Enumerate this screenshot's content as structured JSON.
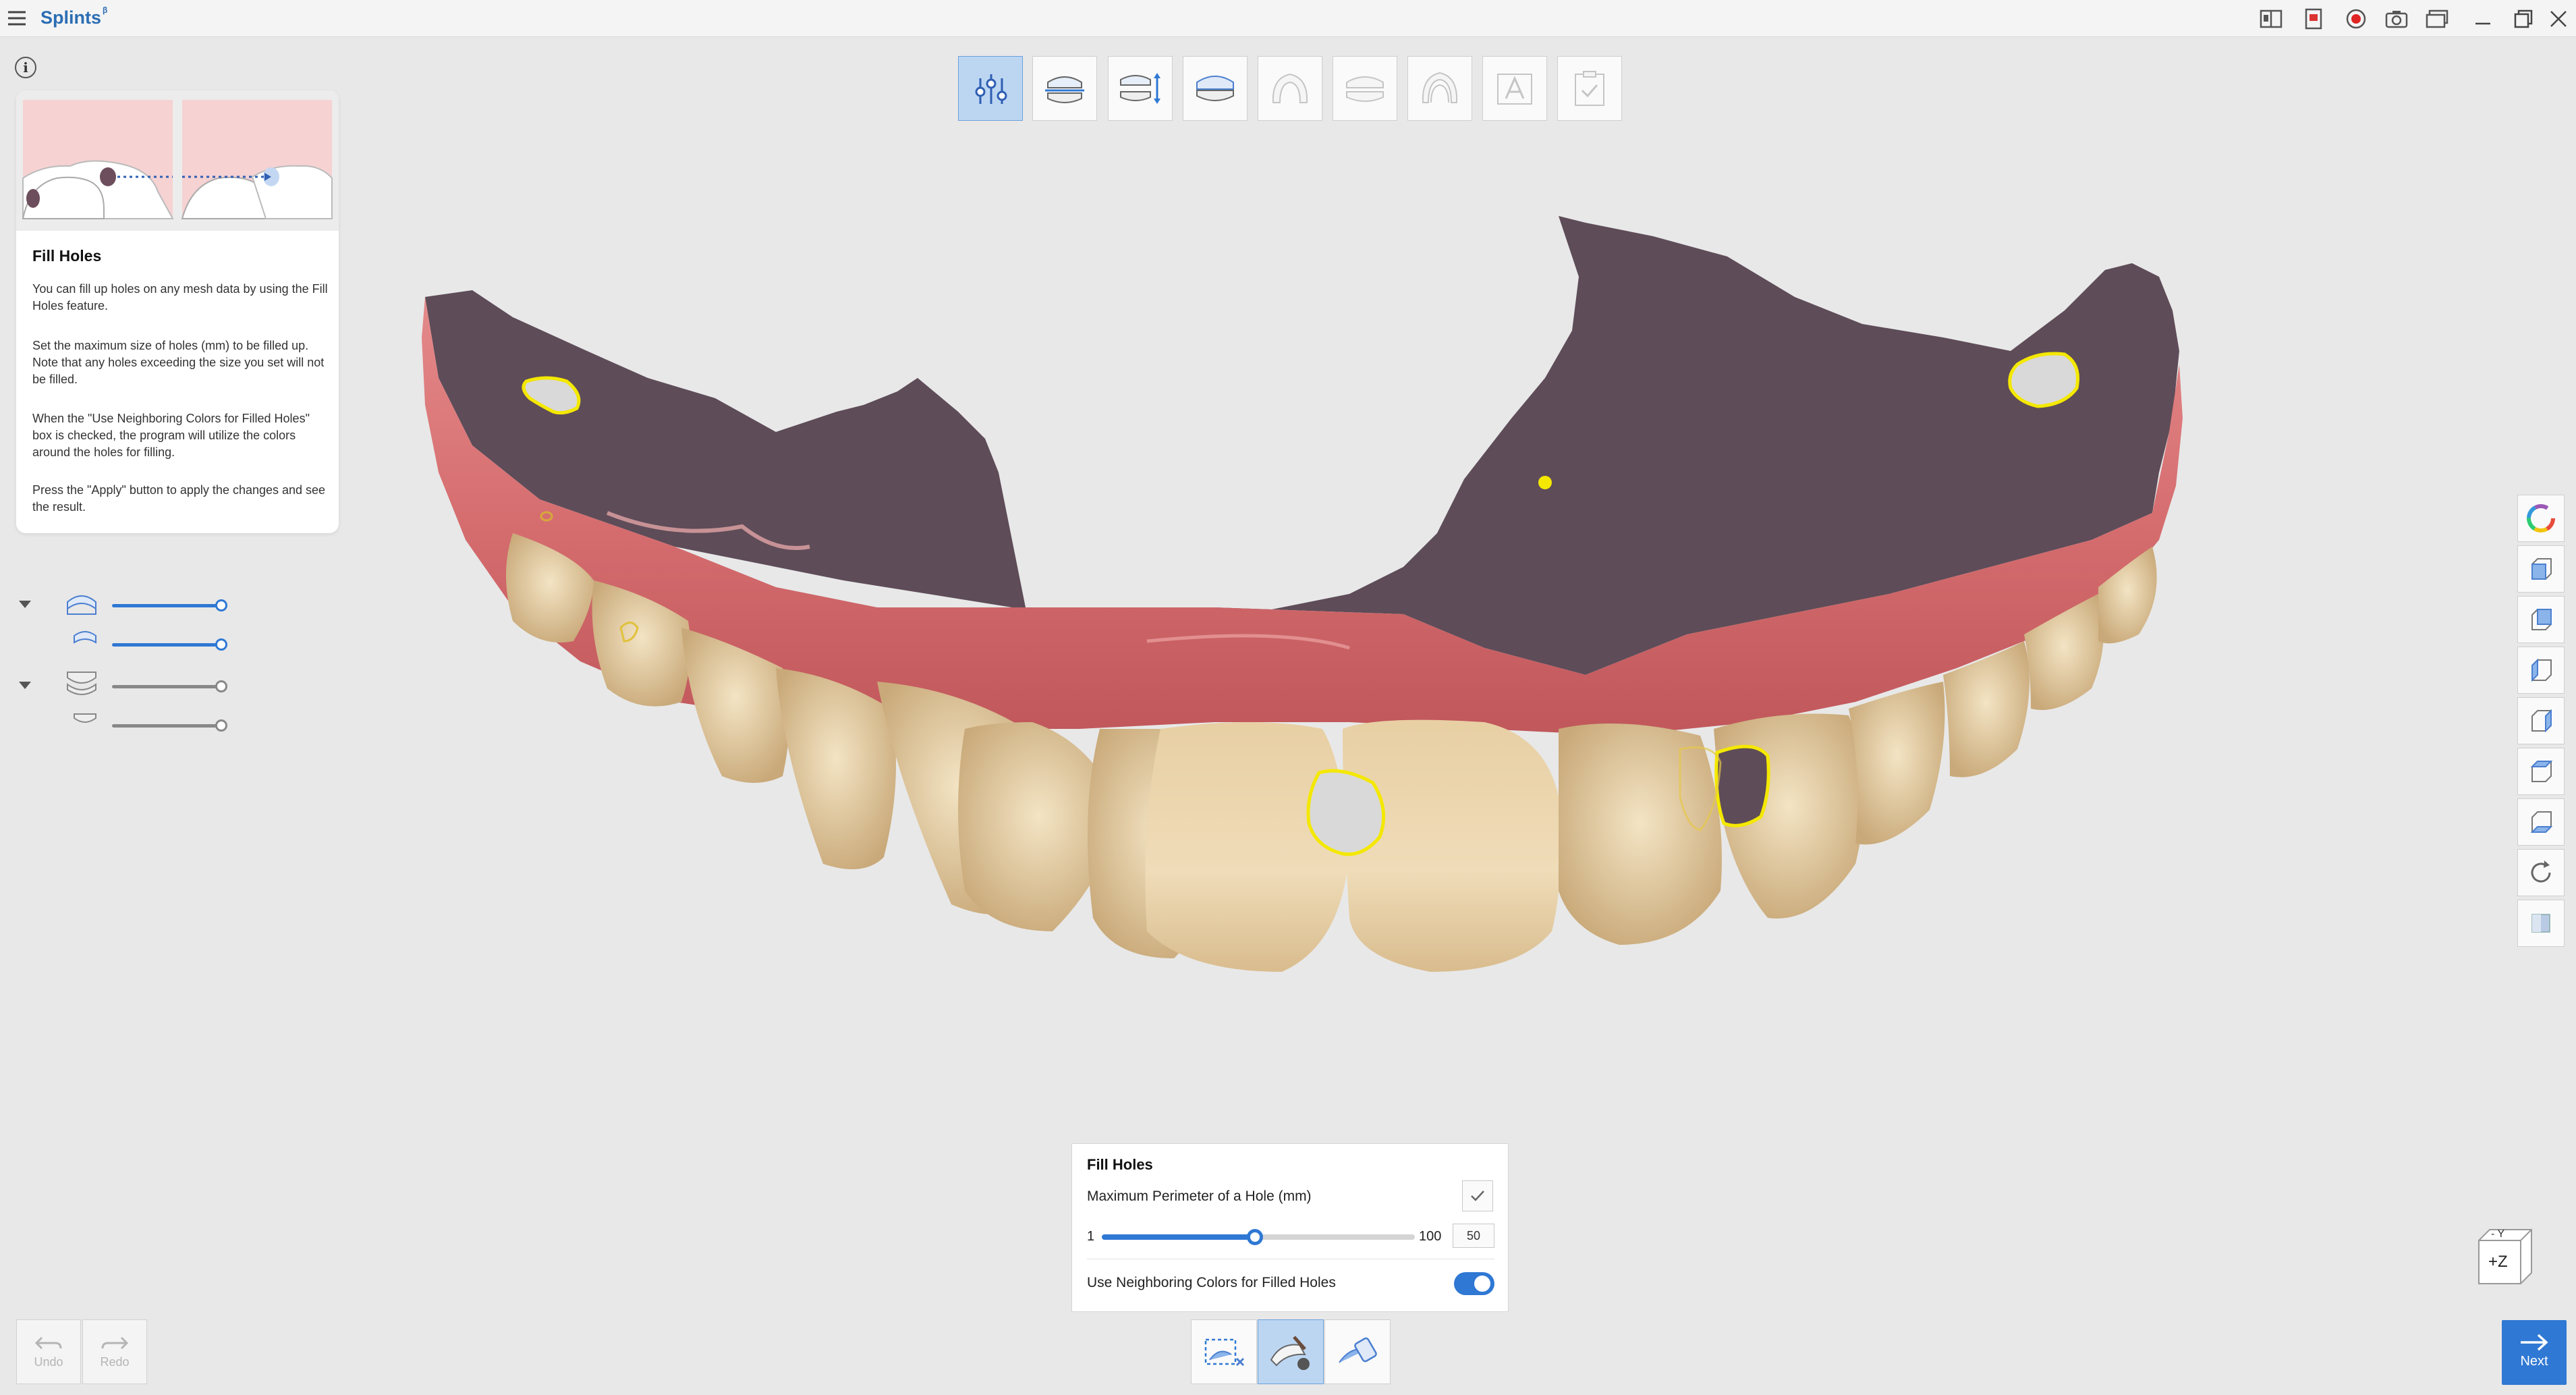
{
  "app": {
    "title": "Splints",
    "badge": "β"
  },
  "titlebar_icons": [
    "split-view-icon",
    "report-icon",
    "record-icon",
    "camera-icon",
    "window-icon",
    "minimize-icon",
    "maximize-icon",
    "close-icon"
  ],
  "help": {
    "title": "Fill Holes",
    "paragraphs": [
      "You can fill up holes on any mesh data by using the Fill Holes feature.",
      "Set the maximum size of holes (mm) to be filled up. Note that any holes exceeding the size you set will not be filled.",
      "When the \"Use Neighboring Colors for Filled Holes\" box is checked, the program will utilize the colors around the holes for filling.",
      "Press the \"Apply\" button to apply the changes and see the result."
    ]
  },
  "layers": [
    {
      "icon": "upper-jaw-icon",
      "visibility": 1.0,
      "group": true
    },
    {
      "icon": "upper-scan-icon",
      "visibility": 1.0,
      "group": false
    },
    {
      "icon": "lower-jaw-icon",
      "visibility": 1.0,
      "group": true
    },
    {
      "icon": "lower-scan-icon",
      "visibility": 1.0,
      "group": false
    }
  ],
  "top_tools": [
    {
      "name": "data-edit-tool",
      "active": true,
      "enabled": true
    },
    {
      "name": "occlusion-tool",
      "active": false,
      "enabled": true
    },
    {
      "name": "align-tool",
      "active": false,
      "enabled": true
    },
    {
      "name": "bite-tool",
      "active": false,
      "enabled": true
    },
    {
      "name": "splint-design-tool",
      "active": false,
      "enabled": false
    },
    {
      "name": "thickness-tool",
      "active": false,
      "enabled": false
    },
    {
      "name": "shell-tool",
      "active": false,
      "enabled": false
    },
    {
      "name": "text-tool",
      "active": false,
      "enabled": false
    },
    {
      "name": "finish-tool",
      "active": false,
      "enabled": false
    }
  ],
  "view_tools": [
    "color-wheel-icon",
    "front-view-icon",
    "back-view-icon",
    "left-view-icon",
    "right-view-icon",
    "top-view-icon",
    "bottom-view-icon",
    "reset-view-icon",
    "texture-icon"
  ],
  "fill_panel": {
    "title": "Fill Holes",
    "max_label": "Maximum Perimeter of a Hole (mm)",
    "min": "1",
    "max": "100",
    "value": "50",
    "value_fraction": 0.49,
    "neighbor_label": "Use Neighboring Colors for Filled Holes",
    "neighbor_on": true
  },
  "modes": [
    {
      "name": "select-area-mode",
      "active": false
    },
    {
      "name": "fill-holes-mode",
      "active": true
    },
    {
      "name": "smooth-mode",
      "active": false
    }
  ],
  "undo_label": "Undo",
  "redo_label": "Redo",
  "next_label": "Next",
  "orient": {
    "top": "- Y",
    "front": "+Z"
  },
  "colors": {
    "accent": "#2f78d4",
    "gum": "#d9787a",
    "palate": "#5e4b57",
    "hole_outline": "#f4e800"
  }
}
